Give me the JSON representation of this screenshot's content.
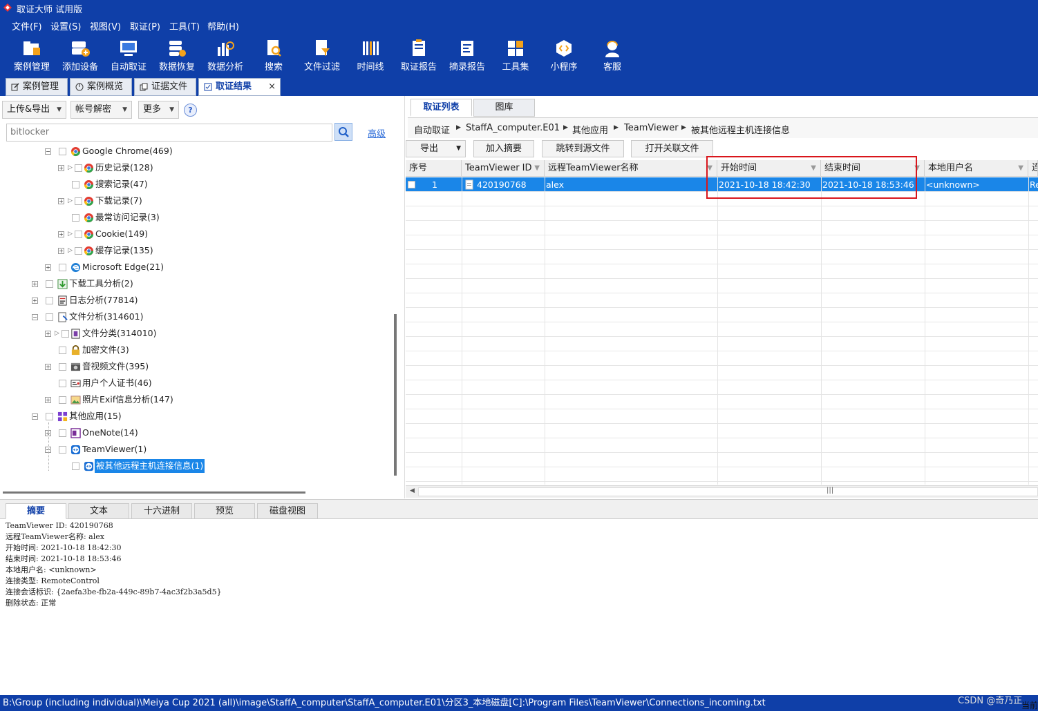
{
  "window": {
    "title": "取证大师 试用版"
  },
  "menu": [
    "文件(F)",
    "设置(S)",
    "视图(V)",
    "取证(P)",
    "工具(T)",
    "帮助(H)"
  ],
  "toolbar": [
    {
      "label": "案例管理",
      "icon": "folder-case-icon"
    },
    {
      "label": "添加设备",
      "icon": "add-device-icon"
    },
    {
      "label": "自动取证",
      "icon": "auto-forensics-icon"
    },
    {
      "label": "数据恢复",
      "icon": "data-recovery-icon"
    },
    {
      "label": "数据分析",
      "icon": "data-analysis-icon"
    },
    {
      "label": "搜索",
      "icon": "search-doc-icon"
    },
    {
      "label": "文件过滤",
      "icon": "file-filter-icon"
    },
    {
      "label": "时间线",
      "icon": "timeline-icon"
    },
    {
      "label": "取证报告",
      "icon": "forensic-report-icon"
    },
    {
      "label": "摘录报告",
      "icon": "excerpt-report-icon"
    },
    {
      "label": "工具集",
      "icon": "toolset-icon"
    },
    {
      "label": "小程序",
      "icon": "mini-program-icon"
    },
    {
      "label": "客服",
      "icon": "customer-service-icon"
    }
  ],
  "main_tabs": [
    {
      "label": "案例管理",
      "active": false
    },
    {
      "label": "案例概览",
      "active": false
    },
    {
      "label": "证据文件",
      "active": false
    },
    {
      "label": "取证结果",
      "active": true,
      "close": "×"
    }
  ],
  "left": {
    "dropdowns": [
      "上传&导出",
      "帐号解密",
      "更多"
    ],
    "help": "?",
    "search_value": "bitlocker",
    "advanced": "高级",
    "tree": [
      {
        "label": "Google Chrome(469)",
        "icon": "chrome-icon"
      },
      {
        "label": "历史记录(128)",
        "icon": "chrome-icon"
      },
      {
        "label": "搜索记录(47)",
        "icon": "chrome-icon"
      },
      {
        "label": "下载记录(7)",
        "icon": "chrome-icon"
      },
      {
        "label": "最常访问记录(3)",
        "icon": "chrome-icon"
      },
      {
        "label": "Cookie(149)",
        "icon": "chrome-icon"
      },
      {
        "label": "缓存记录(135)",
        "icon": "chrome-icon"
      },
      {
        "label": "Microsoft Edge(21)",
        "icon": "edge-icon"
      },
      {
        "label": "下载工具分析(2)",
        "icon": "download-tool-icon"
      },
      {
        "label": "日志分析(77814)",
        "icon": "log-icon"
      },
      {
        "label": "文件分析(314601)",
        "icon": "file-analysis-icon"
      },
      {
        "label": "文件分类(314010)",
        "icon": "file-category-icon"
      },
      {
        "label": "加密文件(3)",
        "icon": "lock-icon"
      },
      {
        "label": "音视频文件(395)",
        "icon": "media-icon"
      },
      {
        "label": "用户个人证书(46)",
        "icon": "certificate-icon"
      },
      {
        "label": "照片Exif信息分析(147)",
        "icon": "photo-icon"
      },
      {
        "label": "其他应用(15)",
        "icon": "apps-icon"
      },
      {
        "label": "OneNote(14)",
        "icon": "onenote-icon"
      },
      {
        "label": "TeamViewer(1)",
        "icon": "teamviewer-icon"
      },
      {
        "label": "被其他远程主机连接信息(1)",
        "icon": "teamviewer-icon",
        "selected": true
      }
    ]
  },
  "right": {
    "tabs": [
      "取证列表",
      "图库"
    ],
    "breadcrumb": [
      "自动取证",
      "StaffA_computer.E01",
      "其他应用",
      "TeamViewer",
      "被其他远程主机连接信息"
    ],
    "actions": [
      "导出",
      "加入摘要",
      "跳转到源文件",
      "打开关联文件"
    ],
    "columns": [
      "序号",
      "TeamViewer ID",
      "远程TeamViewer名称",
      "开始时间",
      "结束时间",
      "本地用户名",
      "连"
    ],
    "rows": [
      {
        "index": "1",
        "id": "420190768",
        "name": "alex",
        "start": "2021-10-18 18:42:30",
        "end": "2021-10-18 18:53:46",
        "user": "<unknown>",
        "conn": "Re"
      }
    ],
    "scroll_glyph": "|||"
  },
  "bottom_tabs": [
    "摘要",
    "文本",
    "十六进制",
    "预览",
    "磁盘视图"
  ],
  "details": [
    "TeamViewer ID: 420190768",
    "远程TeamViewer名称: alex",
    "开始时间: 2021-10-18 18:42:30",
    "结束时间: 2021-10-18 18:53:46",
    "本地用户名: <unknown>",
    "连接类型: RemoteControl",
    "连接会话标识: {2aefa3be-fb2a-449c-89b7-4ac3f2b3a5d5}",
    "删除状态: 正常"
  ],
  "status": "B:\\Group (including individual)\\Meiya Cup 2021 (all)\\image\\StaffA_computer\\StaffA_computer.E01\\分区3_本地磁盘[C]:\\Program Files\\TeamViewer\\Connections_incoming.txt",
  "watermark": "CSDN @奇乃正",
  "corner_text": "当前",
  "colors": {
    "brand": "#0f3fa8",
    "selection": "#1a86e8",
    "highlight_box": "#d9161c"
  }
}
